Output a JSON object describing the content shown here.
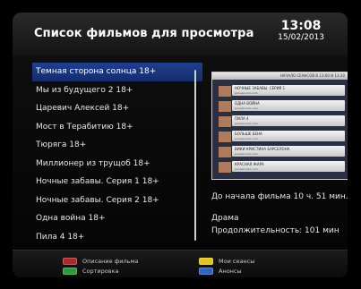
{
  "header": {
    "title": "Список фильмов для просмотра",
    "time": "13:08",
    "date": "15/02/2013"
  },
  "list": {
    "items": [
      {
        "label": "Темная сторона солнца 18+"
      },
      {
        "label": "Мы из будущего 2 18+"
      },
      {
        "label": "Царевич Алексей 18+"
      },
      {
        "label": "Мост в Терабитию 18+"
      },
      {
        "label": "Тюряга  18+"
      },
      {
        "label": "Миллионер из трущоб 18+"
      },
      {
        "label": "Ночные забавы. Серия 1 18+"
      },
      {
        "label": "Ночные забавы. Серия 2 18+"
      },
      {
        "label": "Одна война 18+"
      },
      {
        "label": "Пила 4 18+"
      }
    ],
    "selected_index": 0
  },
  "preview": {
    "header_text": "НАЧАЛО СЕАНСОВ В 13:00 И 13:30",
    "rows": [
      {
        "title": "НОЧНЫЕ ЗАБАВЫ. СЕРИЯ 1",
        "sub": "pvnnaz.com.com"
      },
      {
        "title": "ОДНА ВОЙНА",
        "sub": "pvnnaz.com.com"
      },
      {
        "title": "ПИЛА 4",
        "sub": "pvnnaz.com.com"
      },
      {
        "title": "БОЛЬШЕ БЕНА",
        "sub": "pvnnaz.com.com"
      },
      {
        "title": "ВИКИ КРИСТИНА БАРСЕЛОНА",
        "sub": "pvnnaz.com.com"
      },
      {
        "title": "КРАСНАЯ ЖАРА",
        "sub": "pvnnaz.com.com"
      }
    ]
  },
  "info": {
    "countdown": "До начала фильма 10 ч. 51 мин.",
    "genre": "Драма",
    "duration": "Продолжительность: 101 мин"
  },
  "footer": {
    "red_label": "Описание фильма",
    "green_label": "Сортировка",
    "yellow_label": "Мои сеансы",
    "blue_label": "Анонсы",
    "colors": {
      "red": "#b3262a",
      "green": "#2a9b3a",
      "yellow": "#e7c218",
      "blue": "#2c64c8"
    }
  }
}
